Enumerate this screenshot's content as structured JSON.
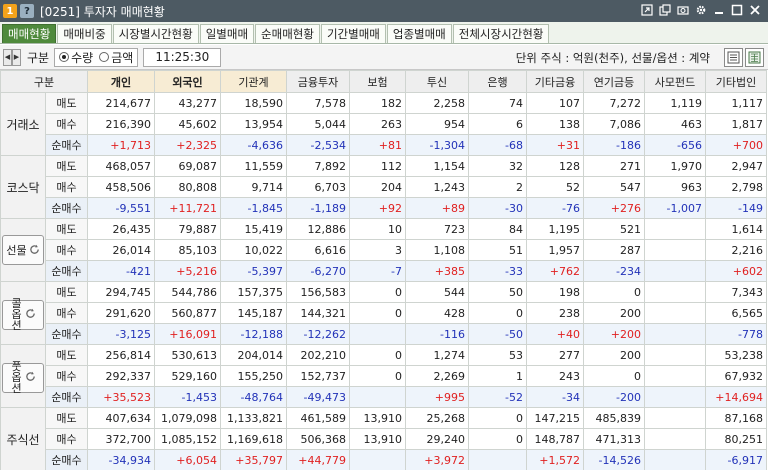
{
  "titlebar": {
    "badge_num": "1",
    "badge_help": "?",
    "title": "[0251] 투자자 매매현황"
  },
  "tabs": [
    "매매현황",
    "매매비중",
    "시장별시간현황",
    "일별매매",
    "순매매현황",
    "기간별매매",
    "업종별매매",
    "전체시장시간현황"
  ],
  "toolbar": {
    "gubun": "구분",
    "radio_qty": "수량",
    "radio_amt": "금액",
    "time": "11:25:30",
    "unit": "단위 주식 : 억원(천주), 선물/옵션 : 계약"
  },
  "grid": {
    "corner": "구분",
    "columns": [
      "개인",
      "외국인",
      "기관계",
      "금융투자",
      "보험",
      "투신",
      "은행",
      "기타금융",
      "연기금등",
      "사모펀드",
      "기타법인"
    ],
    "sub_labels": [
      "매도",
      "매수",
      "순매수"
    ],
    "groups": [
      {
        "name": "거래소",
        "button": false,
        "rows": [
          [
            "214,677",
            "43,277",
            "18,590",
            "7,578",
            "182",
            "2,258",
            "74",
            "107",
            "7,272",
            "1,119",
            "1,117"
          ],
          [
            "216,390",
            "45,602",
            "13,954",
            "5,044",
            "263",
            "954",
            "6",
            "138",
            "7,086",
            "463",
            "1,817"
          ],
          [
            "+1,713",
            "+2,325",
            "-4,636",
            "-2,534",
            "+81",
            "-1,304",
            "-68",
            "+31",
            "-186",
            "-656",
            "+700"
          ]
        ]
      },
      {
        "name": "코스닥",
        "button": false,
        "rows": [
          [
            "468,057",
            "69,087",
            "11,559",
            "7,892",
            "112",
            "1,154",
            "32",
            "128",
            "271",
            "1,970",
            "2,947"
          ],
          [
            "458,506",
            "80,808",
            "9,714",
            "6,703",
            "204",
            "1,243",
            "2",
            "52",
            "547",
            "963",
            "2,798"
          ],
          [
            "-9,551",
            "+11,721",
            "-1,845",
            "-1,189",
            "+92",
            "+89",
            "-30",
            "-76",
            "+276",
            "-1,007",
            "-149"
          ]
        ]
      },
      {
        "name": "선물",
        "button": true,
        "rows": [
          [
            "26,435",
            "79,887",
            "15,419",
            "12,886",
            "10",
            "723",
            "84",
            "1,195",
            "521",
            "",
            "1,614"
          ],
          [
            "26,014",
            "85,103",
            "10,022",
            "6,616",
            "3",
            "1,108",
            "51",
            "1,957",
            "287",
            "",
            "2,216"
          ],
          [
            "-421",
            "+5,216",
            "-5,397",
            "-6,270",
            "-7",
            "+385",
            "-33",
            "+762",
            "-234",
            "",
            "+602"
          ]
        ]
      },
      {
        "name": "콜옵션",
        "button": true,
        "rows": [
          [
            "294,745",
            "544,786",
            "157,375",
            "156,583",
            "0",
            "544",
            "50",
            "198",
            "0",
            "",
            "7,343"
          ],
          [
            "291,620",
            "560,877",
            "145,187",
            "144,321",
            "0",
            "428",
            "0",
            "238",
            "200",
            "",
            "6,565"
          ],
          [
            "-3,125",
            "+16,091",
            "-12,188",
            "-12,262",
            "",
            "-116",
            "-50",
            "+40",
            "+200",
            "",
            "-778"
          ]
        ]
      },
      {
        "name": "풋옵션",
        "button": true,
        "rows": [
          [
            "256,814",
            "530,613",
            "204,014",
            "202,210",
            "0",
            "1,274",
            "53",
            "277",
            "200",
            "",
            "53,238"
          ],
          [
            "292,337",
            "529,160",
            "155,250",
            "152,737",
            "0",
            "2,269",
            "1",
            "243",
            "0",
            "",
            "67,932"
          ],
          [
            "+35,523",
            "-1,453",
            "-48,764",
            "-49,473",
            "",
            "+995",
            "-52",
            "-34",
            "-200",
            "",
            "+14,694"
          ]
        ]
      },
      {
        "name": "주식선",
        "button": false,
        "rows": [
          [
            "407,634",
            "1,079,098",
            "1,133,821",
            "461,589",
            "13,910",
            "25,268",
            "0",
            "147,215",
            "485,839",
            "",
            "87,168"
          ],
          [
            "372,700",
            "1,085,152",
            "1,169,618",
            "506,368",
            "13,910",
            "29,240",
            "0",
            "148,787",
            "471,313",
            "",
            "80,251"
          ],
          [
            "-34,934",
            "+6,054",
            "+35,797",
            "+44,779",
            "",
            "+3,972",
            "",
            "+1,572",
            "-14,526",
            "",
            "-6,917"
          ]
        ]
      }
    ]
  }
}
